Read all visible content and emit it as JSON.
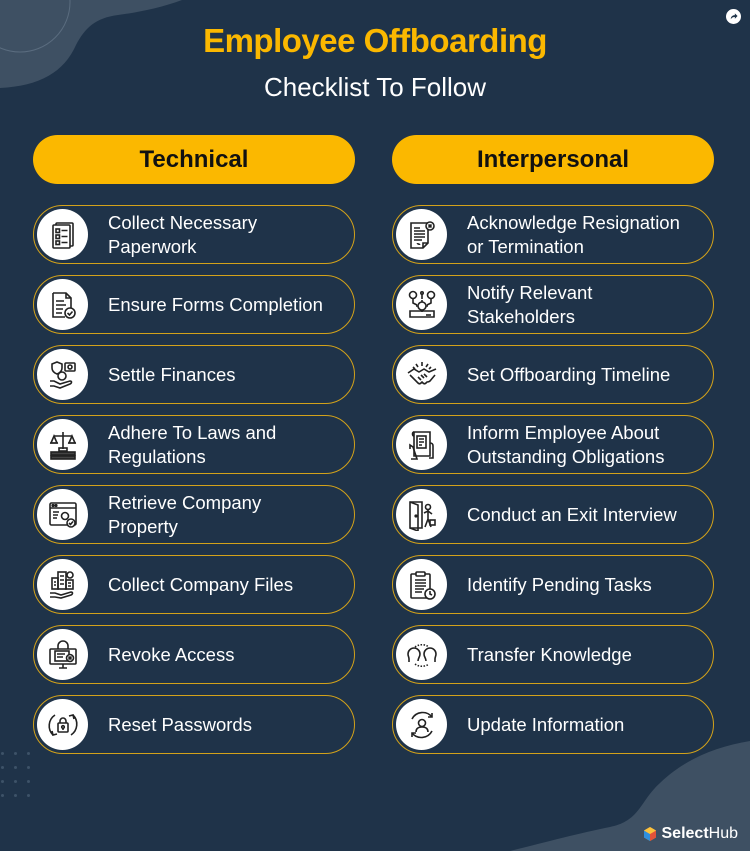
{
  "title": "Employee Offboarding",
  "subtitle": "Checklist To Follow",
  "colors": {
    "background": "#1f3349",
    "accent": "#fbb800",
    "border": "#d3a21a",
    "shape": "#3e5063"
  },
  "columns": [
    {
      "header": "Technical",
      "items": [
        {
          "label": "Collect Necessary Paperwork",
          "icon": "paperwork-checklist-icon"
        },
        {
          "label": "Ensure Forms Completion",
          "icon": "form-check-icon"
        },
        {
          "label": "Settle Finances",
          "icon": "money-hand-icon"
        },
        {
          "label": "Adhere To Laws and Regulations",
          "icon": "scales-of-justice-icon"
        },
        {
          "label": "Retrieve Company Property",
          "icon": "browser-gear-icon"
        },
        {
          "label": "Collect Company Files",
          "icon": "buildings-hand-icon"
        },
        {
          "label": "Revoke Access",
          "icon": "locked-computer-icon"
        },
        {
          "label": "Reset Passwords",
          "icon": "lock-refresh-icon"
        }
      ]
    },
    {
      "header": "Interpersonal",
      "items": [
        {
          "label": "Acknowledge Resignation or Termination",
          "icon": "document-cancel-icon"
        },
        {
          "label": "Notify Relevant Stakeholders",
          "icon": "stakeholders-gear-icon"
        },
        {
          "label": "Set Offboarding Timeline",
          "icon": "handshake-icon"
        },
        {
          "label": "Inform Employee About Outstanding Obligations",
          "icon": "obligation-notice-icon"
        },
        {
          "label": "Conduct an Exit Interview",
          "icon": "exit-door-person-icon"
        },
        {
          "label": "Identify Pending Tasks",
          "icon": "clipboard-clock-icon"
        },
        {
          "label": "Transfer Knowledge",
          "icon": "heads-exchange-icon"
        },
        {
          "label": "Update Information",
          "icon": "user-refresh-icon"
        }
      ]
    }
  ],
  "branding": {
    "logo_bold": "Select",
    "logo_regular": "Hub"
  }
}
